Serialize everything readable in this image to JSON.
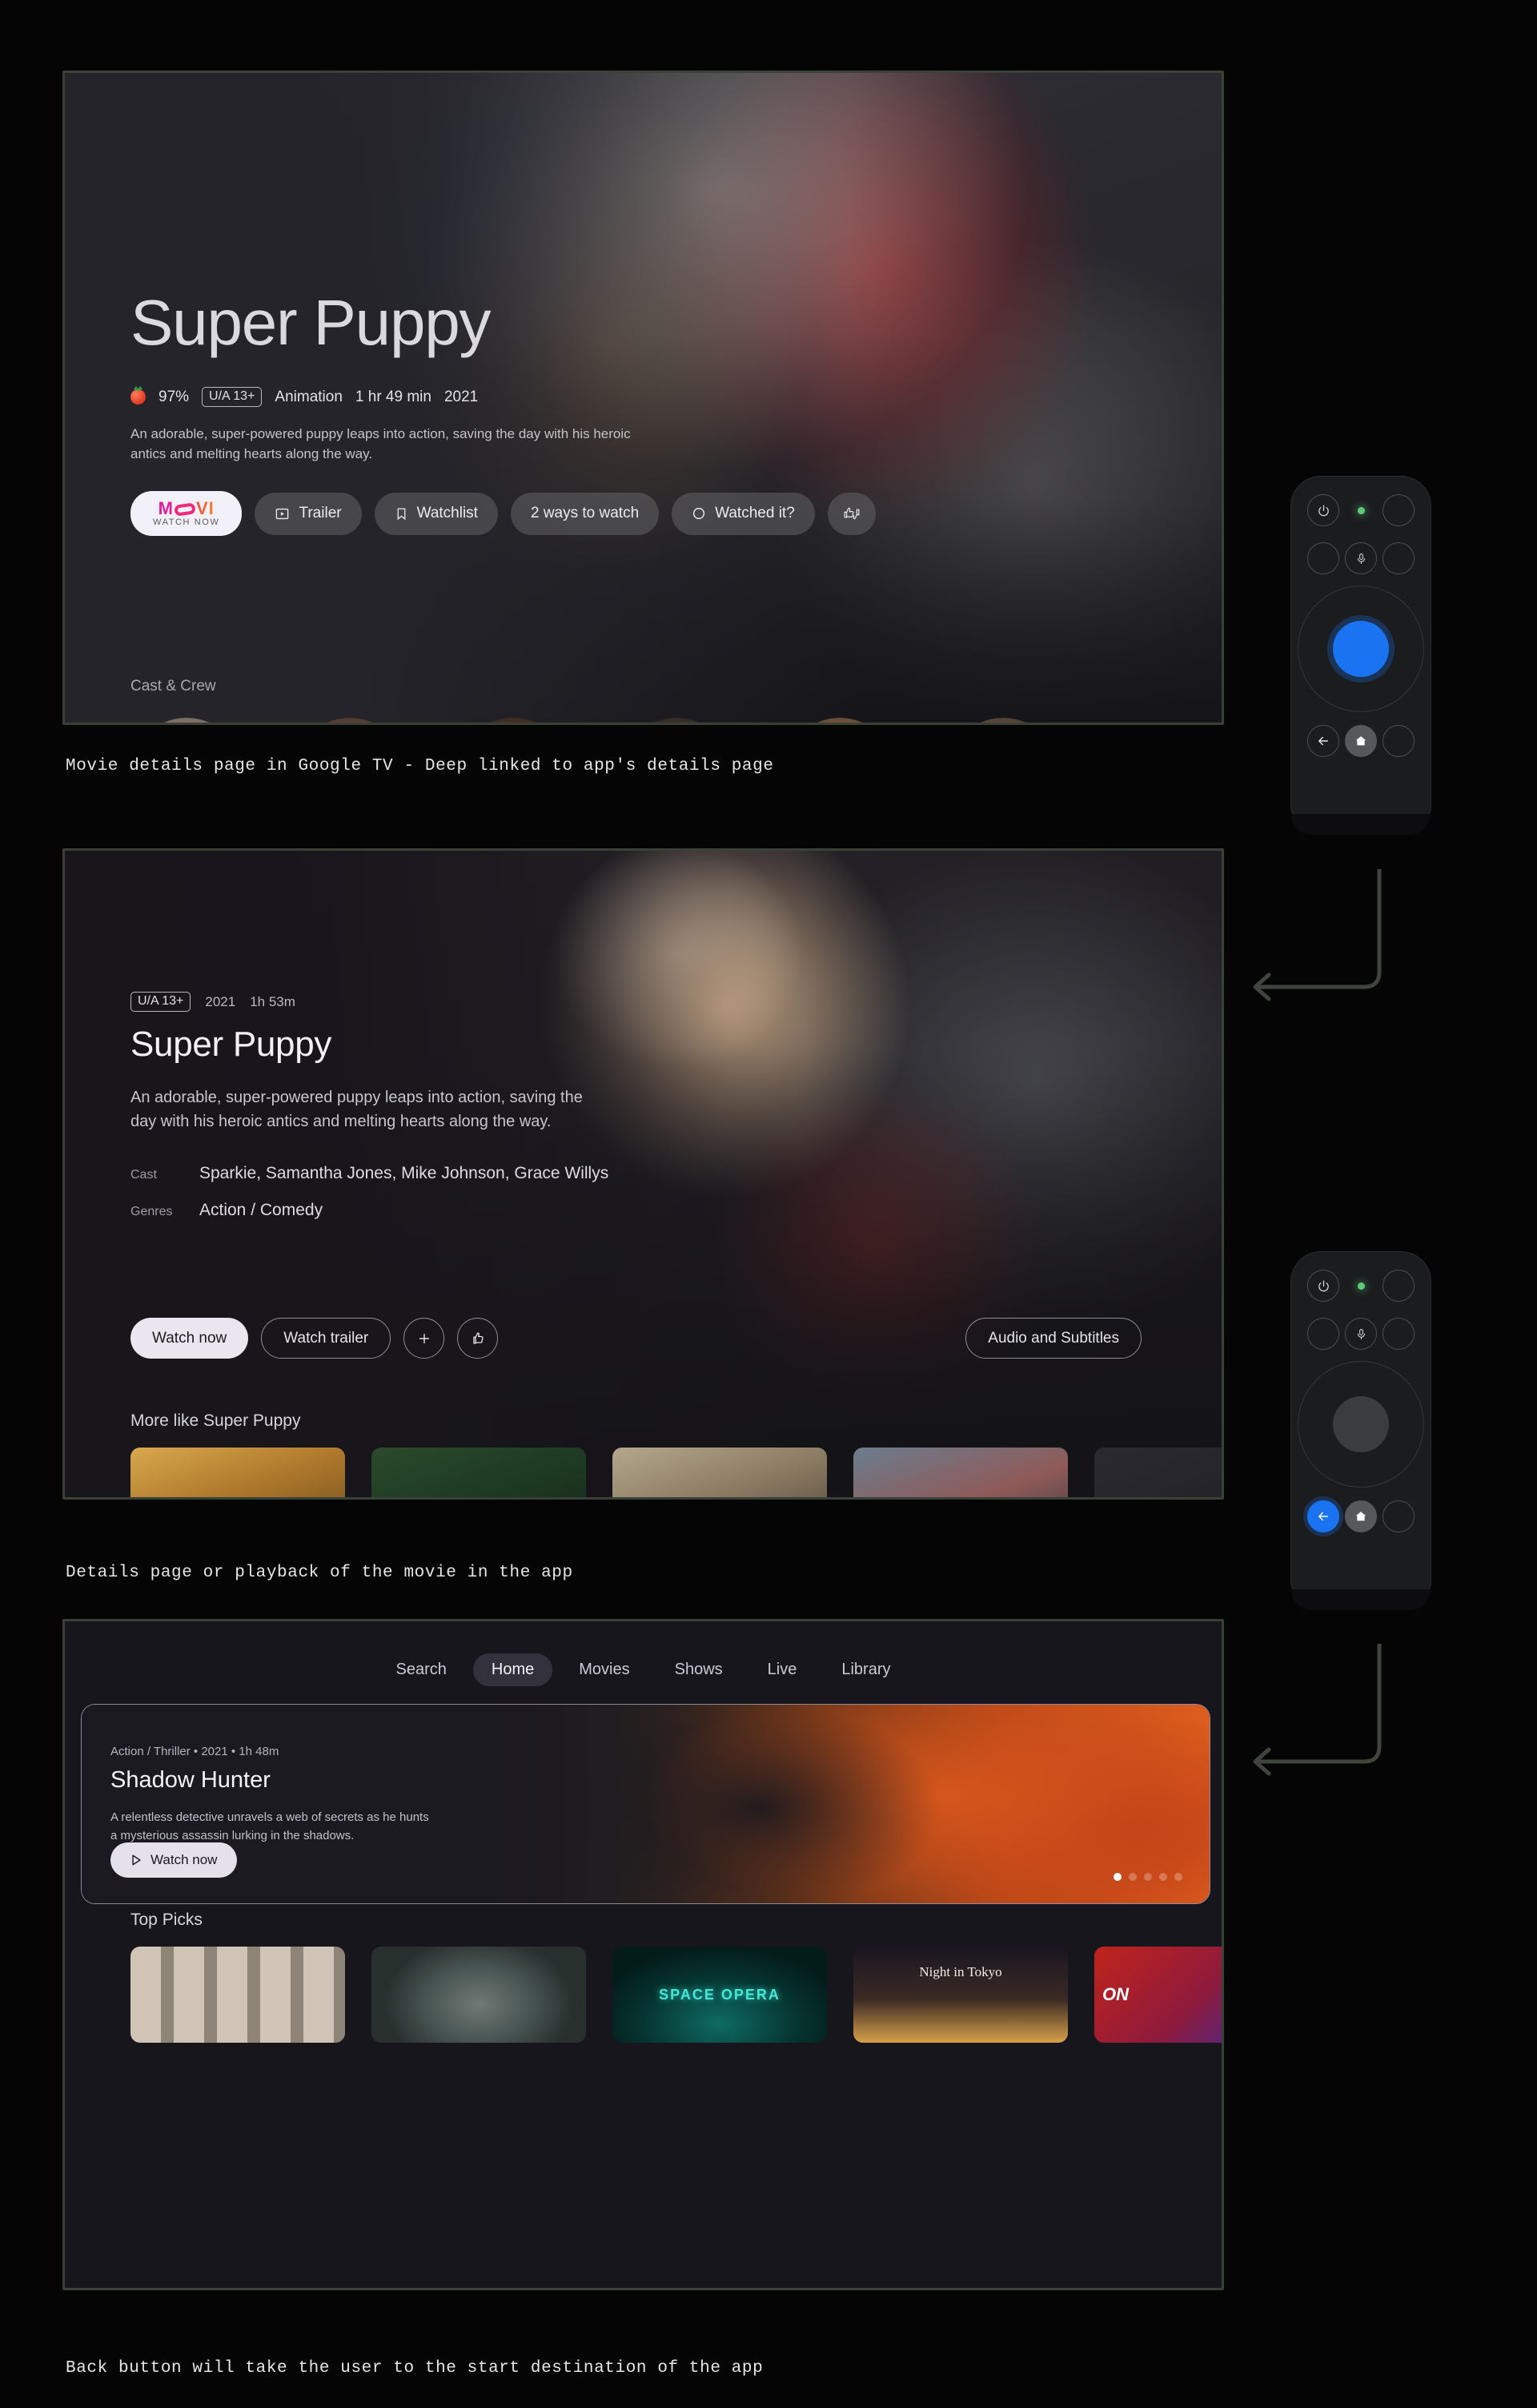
{
  "captions": {
    "one": "Movie details page in Google TV - Deep linked to app's details page",
    "two": "Details page or playback of the movie in the app",
    "three": "Back button will take the user to the start destination of the app"
  },
  "panel_google_tv": {
    "title": "Super Puppy",
    "rating_score": "97%",
    "age_rating": "U/A 13+",
    "genre": "Animation",
    "duration": "1 hr 49 min",
    "year": "2021",
    "description": "An adorable, super-powered puppy leaps into action, saving the day with his heroic antics and melting hearts along the way.",
    "actions": [
      {
        "label": "MOVI",
        "sublabel": "WATCH NOW",
        "icon": "movi-logo",
        "style": "app"
      },
      {
        "label": "Trailer",
        "icon": "play-box-icon",
        "style": "ghost"
      },
      {
        "label": "Watchlist",
        "icon": "bookmark-icon",
        "style": "ghost"
      },
      {
        "label": "2 ways to watch",
        "icon": "",
        "style": "ghost"
      },
      {
        "label": "Watched it?",
        "icon": "circle-icon",
        "style": "ghost"
      },
      {
        "label": "",
        "icon": "thumbs-updown-icon",
        "style": "ghost-icon"
      }
    ],
    "cast_section_label": "Cast & Crew"
  },
  "panel_app_details": {
    "age_rating": "U/A 13+",
    "year": "2021",
    "duration": "1h 53m",
    "title": "Super Puppy",
    "description": "An adorable, super-powered puppy leaps into action, saving the day with his heroic antics and melting hearts along the way.",
    "facts": [
      {
        "key": "Cast",
        "value": "Sparkie, Samantha Jones, Mike Johnson, Grace Willys"
      },
      {
        "key": "Genres",
        "value": "Action / Comedy"
      }
    ],
    "primary_action": "Watch now",
    "secondary_action": "Watch trailer",
    "add_icon": "plus-icon",
    "like_icon": "thumbs-up-icon",
    "audio_subtitles": "Audio and Subtitles",
    "more_like_label": "More like Super Puppy",
    "more_like_posters": [
      "tiger-cub",
      "green-forest",
      "monkeys",
      "colorful-birds",
      "fifth-card"
    ]
  },
  "panel_app_home": {
    "nav": [
      {
        "label": "Search",
        "active": false
      },
      {
        "label": "Home",
        "active": true
      },
      {
        "label": "Movies",
        "active": false
      },
      {
        "label": "Shows",
        "active": false
      },
      {
        "label": "Live",
        "active": false
      },
      {
        "label": "Library",
        "active": false
      }
    ],
    "hero": {
      "meta": "Action / Thriller • 2021 • 1h 48m",
      "title": "Shadow Hunter",
      "description": "A relentless detective unravels a web of secrets as he hunts a mysterious assassin lurking in the shadows.",
      "cta": "Watch now",
      "dots_total": 5,
      "dots_active": 1
    },
    "top_picks_label": "Top Picks",
    "top_picks": [
      {
        "name": "men-in-suits",
        "caption": ""
      },
      {
        "name": "ape-portrait",
        "caption": ""
      },
      {
        "name": "space-opera",
        "caption": "SPACE OPERA"
      },
      {
        "name": "night-in-tokyo",
        "caption": "Night in Tokyo"
      },
      {
        "name": "neon-one",
        "caption": "ON"
      }
    ]
  },
  "remotes": [
    {
      "name": "remote-top",
      "power_icon": "power-icon",
      "led": "green",
      "mic_icon": "mic-icon",
      "back_icon": "back-arrow-icon",
      "home_icon": "home-icon",
      "dpad_state": "select-highlighted",
      "back_state": "normal"
    },
    {
      "name": "remote-bottom",
      "power_icon": "power-icon",
      "led": "green",
      "mic_icon": "mic-icon",
      "back_icon": "back-arrow-icon",
      "home_icon": "home-icon",
      "dpad_state": "normal",
      "back_state": "highlighted"
    }
  ],
  "colors": {
    "accent_blue": "#1a73f0",
    "led_green": "#5ec97a",
    "frame_border": "#3a4136",
    "page_background": "#050505"
  }
}
